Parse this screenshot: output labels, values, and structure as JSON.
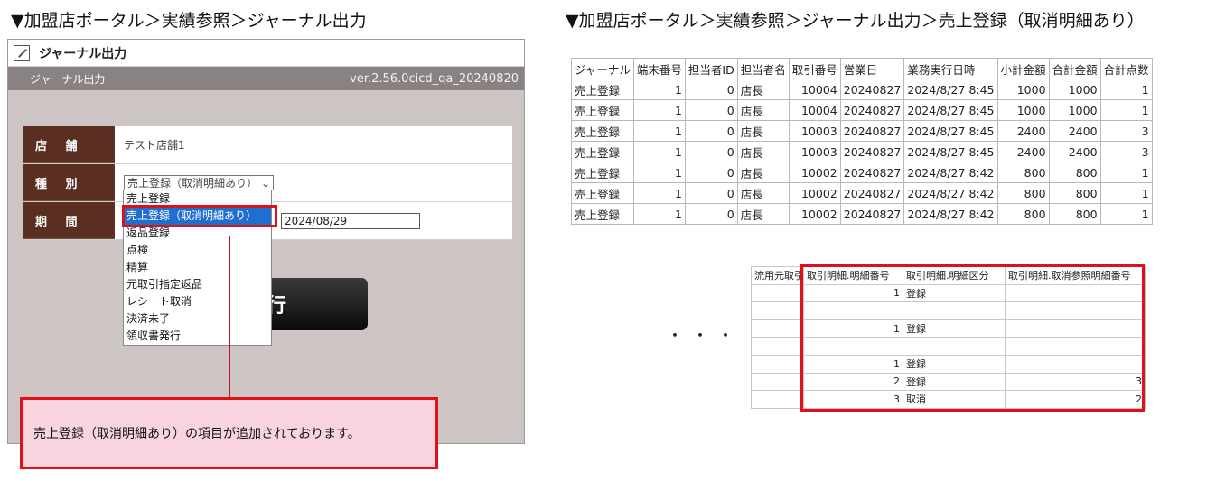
{
  "breadcrumb_left": "▼加盟店ポータル＞実績参照＞ジャーナル出力",
  "breadcrumb_right": "▼加盟店ポータル＞実績参照＞ジャーナル出力＞売上登録（取消明細あり）",
  "app": {
    "title": "ジャーナル出力",
    "subbar_label": "ジャーナル出力",
    "version": "ver.2.56.0cicd_qa_20240820",
    "form": {
      "store_label": "店 舗",
      "store_value": "テスト店舗1",
      "type_label": "種 別",
      "type_selected": "売上登録（取消明細あり）",
      "period_label": "期 間",
      "period_to": "2024/08/29"
    },
    "dropdown_options": [
      "売上登録",
      "売上登録（取消明細あり）",
      "返品登録",
      "点検",
      "精算",
      "元取引指定返品",
      "レシート取消",
      "決済未了",
      "領収書発行"
    ],
    "exec_button_visible_text": "行"
  },
  "callout_text": "売上登録（取消明細あり）の項目が追加されております。",
  "journal_table": {
    "headers": [
      "ジャーナル",
      "端末番号",
      "担当者ID",
      "担当者名",
      "取引番号",
      "営業日",
      "業務実行日時",
      "小計金額",
      "合計金額",
      "合計点数"
    ],
    "rows": [
      [
        "売上登録",
        "1",
        "0",
        "店長",
        "10004",
        "20240827",
        "2024/8/27 8:45",
        "1000",
        "1000",
        "1"
      ],
      [
        "売上登録",
        "1",
        "0",
        "店長",
        "10004",
        "20240827",
        "2024/8/27 8:45",
        "1000",
        "1000",
        "1"
      ],
      [
        "売上登録",
        "1",
        "0",
        "店長",
        "10003",
        "20240827",
        "2024/8/27 8:45",
        "2400",
        "2400",
        "3"
      ],
      [
        "売上登録",
        "1",
        "0",
        "店長",
        "10003",
        "20240827",
        "2024/8/27 8:45",
        "2400",
        "2400",
        "3"
      ],
      [
        "売上登録",
        "1",
        "0",
        "店長",
        "10002",
        "20240827",
        "2024/8/27 8:42",
        "800",
        "800",
        "1"
      ],
      [
        "売上登録",
        "1",
        "0",
        "店長",
        "10002",
        "20240827",
        "2024/8/27 8:42",
        "800",
        "800",
        "1"
      ],
      [
        "売上登録",
        "1",
        "0",
        "店長",
        "10002",
        "20240827",
        "2024/8/27 8:42",
        "800",
        "800",
        "1"
      ]
    ]
  },
  "ellipsis": "・・・",
  "detail_table": {
    "headers": [
      "流用元取引",
      "取引明細.明細番号",
      "取引明細.明細区分",
      "取引明細.取消参照明細番号"
    ],
    "rows": [
      [
        "",
        "1",
        "登録",
        ""
      ],
      [
        "",
        "",
        "",
        ""
      ],
      [
        "",
        "1",
        "登録",
        ""
      ],
      [
        "",
        "",
        "",
        ""
      ],
      [
        "",
        "1",
        "登録",
        ""
      ],
      [
        "",
        "2",
        "登録",
        "3"
      ],
      [
        "",
        "3",
        "取消",
        "2"
      ]
    ]
  },
  "colors": {
    "accent_red": "#e0101a",
    "label_brown": "#5a2f21",
    "select_blue": "#1f6fd1",
    "callout_bg": "#f8d5de"
  }
}
